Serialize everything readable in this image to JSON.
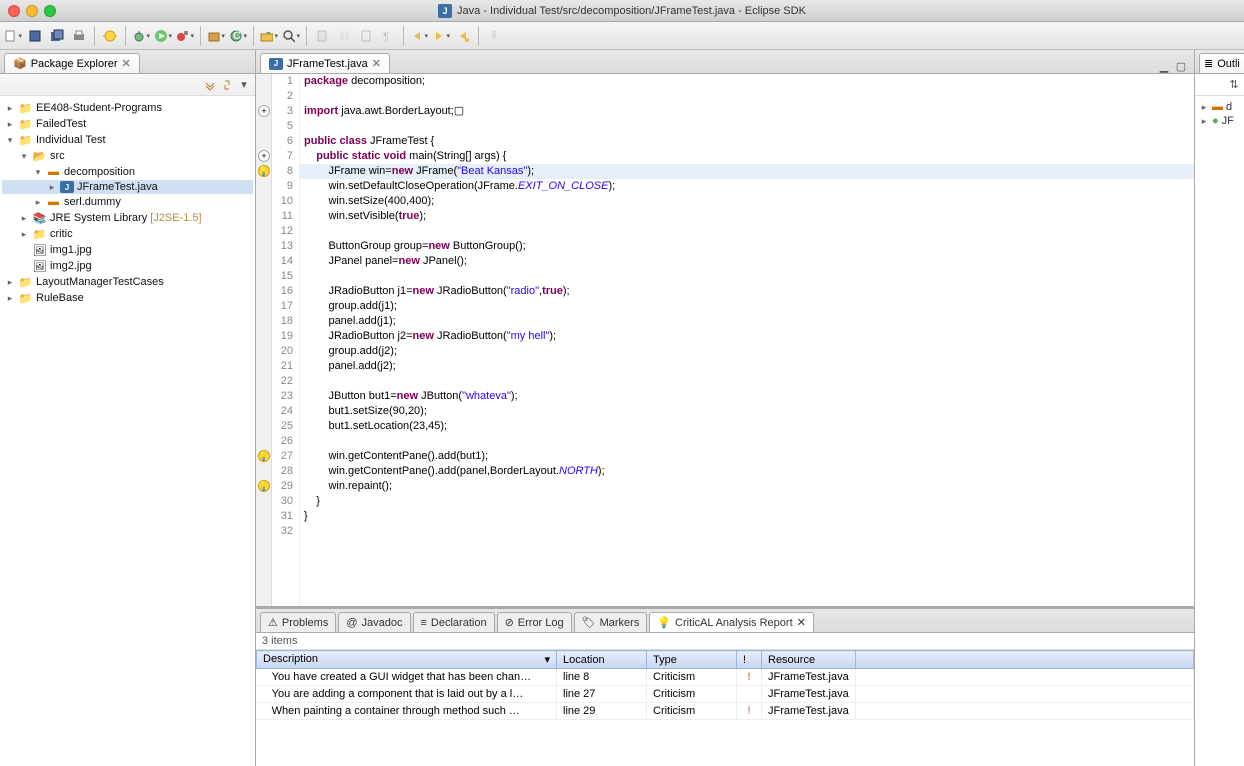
{
  "window": {
    "title": "Java - Individual Test/src/decomposition/JFrameTest.java - Eclipse SDK"
  },
  "package_explorer": {
    "title": "Package Explorer",
    "nodes": [
      {
        "indent": 0,
        "expand": "▸",
        "icon": "proj",
        "label": "EE408-Student-Programs"
      },
      {
        "indent": 0,
        "expand": "▸",
        "icon": "proj",
        "label": "FailedTest"
      },
      {
        "indent": 0,
        "expand": "▾",
        "icon": "proj",
        "label": "Individual Test"
      },
      {
        "indent": 1,
        "expand": "▾",
        "icon": "src",
        "label": "src"
      },
      {
        "indent": 2,
        "expand": "▾",
        "icon": "pkg",
        "label": "decomposition"
      },
      {
        "indent": 3,
        "expand": "▸",
        "icon": "java",
        "label": "JFrameTest.java",
        "sel": true
      },
      {
        "indent": 2,
        "expand": "▸",
        "icon": "pkg",
        "label": "serl.dummy"
      },
      {
        "indent": 1,
        "expand": "▸",
        "icon": "lib",
        "label": "JRE System Library",
        "suffix": "[J2SE-1.5]"
      },
      {
        "indent": 1,
        "expand": "▸",
        "icon": "fold",
        "label": "critic"
      },
      {
        "indent": 1,
        "expand": "",
        "icon": "img",
        "label": "img1.jpg"
      },
      {
        "indent": 1,
        "expand": "",
        "icon": "img",
        "label": "img2.jpg"
      },
      {
        "indent": 0,
        "expand": "▸",
        "icon": "proj",
        "label": "LayoutManagerTestCases"
      },
      {
        "indent": 0,
        "expand": "▸",
        "icon": "proj",
        "label": "RuleBase"
      }
    ]
  },
  "editor": {
    "filename": "JFrameTest.java",
    "highlighted_line": 8,
    "markers": [
      {
        "line": 3,
        "kind": "plus"
      },
      {
        "line": 7,
        "kind": "plus"
      },
      {
        "line": 8,
        "kind": "bulb"
      },
      {
        "line": 27,
        "kind": "bulb"
      },
      {
        "line": 29,
        "kind": "bulb"
      }
    ],
    "lines": [
      {
        "n": 1,
        "html": "<span class='kw'>package</span> decomposition;"
      },
      {
        "n": 2,
        "html": ""
      },
      {
        "n": 3,
        "html": "<span class='kw'>import</span> java.awt.BorderLayout;▢"
      },
      {
        "n": 5,
        "html": ""
      },
      {
        "n": 6,
        "html": "<span class='kw'>public class</span> JFrameTest {"
      },
      {
        "n": 7,
        "html": "    <span class='kw'>public static void</span> main(String[] args) {"
      },
      {
        "n": 8,
        "html": "        JFrame win=<span class='kw'>new</span> JFrame(<span class='str'>\"Beat Kansas\"</span>);"
      },
      {
        "n": 9,
        "html": "        win.setDefaultCloseOperation(JFrame.<span class='fld'>EXIT_ON_CLOSE</span>);"
      },
      {
        "n": 10,
        "html": "        win.setSize(400,400);"
      },
      {
        "n": 11,
        "html": "        win.setVisible(<span class='kw'>true</span>);"
      },
      {
        "n": 12,
        "html": ""
      },
      {
        "n": 13,
        "html": "        ButtonGroup group=<span class='kw'>new</span> ButtonGroup();"
      },
      {
        "n": 14,
        "html": "        JPanel panel=<span class='kw'>new</span> JPanel();"
      },
      {
        "n": 15,
        "html": ""
      },
      {
        "n": 16,
        "html": "        JRadioButton j1=<span class='kw'>new</span> JRadioButton(<span class='str'>\"radio\"</span>,<span class='kw'>true</span>);"
      },
      {
        "n": 17,
        "html": "        group.add(j1);"
      },
      {
        "n": 18,
        "html": "        panel.add(j1);"
      },
      {
        "n": 19,
        "html": "        JRadioButton j2=<span class='kw'>new</span> JRadioButton(<span class='str'>\"my hell\"</span>);"
      },
      {
        "n": 20,
        "html": "        group.add(j2);"
      },
      {
        "n": 21,
        "html": "        panel.add(j2);"
      },
      {
        "n": 22,
        "html": ""
      },
      {
        "n": 23,
        "html": "        JButton but1=<span class='kw'>new</span> JButton(<span class='str'>\"whateva\"</span>);"
      },
      {
        "n": 24,
        "html": "        but1.setSize(90,20);"
      },
      {
        "n": 25,
        "html": "        but1.setLocation(23,45);"
      },
      {
        "n": 26,
        "html": ""
      },
      {
        "n": 27,
        "html": "        win.getContentPane().add(but1);"
      },
      {
        "n": 28,
        "html": "        win.getContentPane().add(panel,BorderLayout.<span class='fld'>NORTH</span>);"
      },
      {
        "n": 29,
        "html": "        win.repaint();"
      },
      {
        "n": 30,
        "html": "    }"
      },
      {
        "n": 31,
        "html": "}"
      },
      {
        "n": 32,
        "html": ""
      }
    ]
  },
  "bottom": {
    "tabs": [
      "Problems",
      "Javadoc",
      "Declaration",
      "Error Log",
      "Markers",
      "CriticAL Analysis Report"
    ],
    "active_tab": 5,
    "items_label": "3 items",
    "headers": [
      "Description",
      "Location",
      "Type",
      "!",
      "Resource"
    ],
    "rows": [
      {
        "desc": "You have created a GUI widget that has been chan…",
        "loc": "line 8",
        "type": "Criticism",
        "pri": "!",
        "res": "JFrameTest.java"
      },
      {
        "desc": "You are adding a component that is laid out by a l…",
        "loc": "line 27",
        "type": "Criticism",
        "pri": "",
        "res": "JFrameTest.java"
      },
      {
        "desc": "When painting a container through method such …",
        "loc": "line 29",
        "type": "Criticism",
        "pri": "!",
        "res": "JFrameTest.java"
      }
    ]
  },
  "outline": {
    "title": "Outli",
    "items": [
      "d",
      "JF"
    ]
  }
}
